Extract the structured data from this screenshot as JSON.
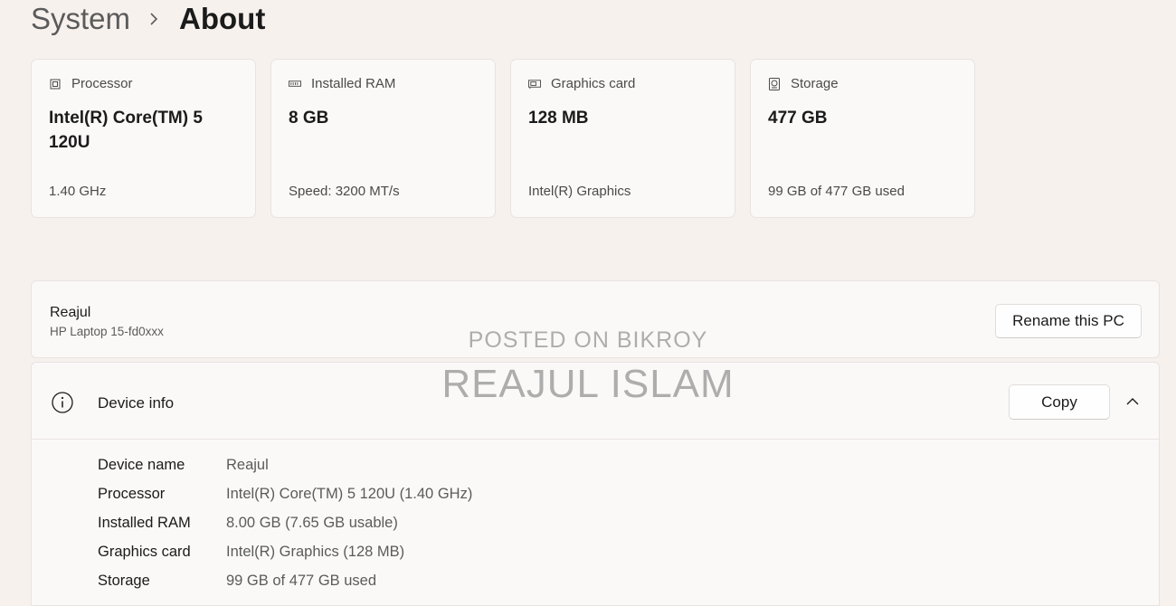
{
  "breadcrumb": {
    "parent": "System",
    "current": "About"
  },
  "cards": [
    {
      "icon": "processor-icon",
      "label": "Processor",
      "value": "Intel(R) Core(TM) 5 120U",
      "detail": "1.40 GHz"
    },
    {
      "icon": "ram-icon",
      "label": "Installed RAM",
      "value": "8 GB",
      "detail": "Speed: 3200 MT/s"
    },
    {
      "icon": "graphics-card-icon",
      "label": "Graphics card",
      "value": "128 MB",
      "detail": "Intel(R) Graphics"
    },
    {
      "icon": "storage-icon",
      "label": "Storage",
      "value": "477 GB",
      "detail": "99 GB of 477 GB used"
    }
  ],
  "pc": {
    "name": "Reajul",
    "model": "HP Laptop 15-fd0xxx",
    "rename_label": "Rename this PC"
  },
  "device_info": {
    "title": "Device info",
    "copy_label": "Copy",
    "rows": [
      {
        "label": "Device name",
        "value": "Reajul"
      },
      {
        "label": "Processor",
        "value": "Intel(R) Core(TM) 5 120U (1.40 GHz)"
      },
      {
        "label": "Installed RAM",
        "value": "8.00 GB (7.65 GB usable)"
      },
      {
        "label": "Graphics card",
        "value": "Intel(R) Graphics (128 MB)"
      },
      {
        "label": "Storage",
        "value": "99 GB of 477 GB used"
      }
    ]
  },
  "watermark": {
    "line1": "POSTED ON BIKROY",
    "line2": "REAJUL ISLAM"
  }
}
